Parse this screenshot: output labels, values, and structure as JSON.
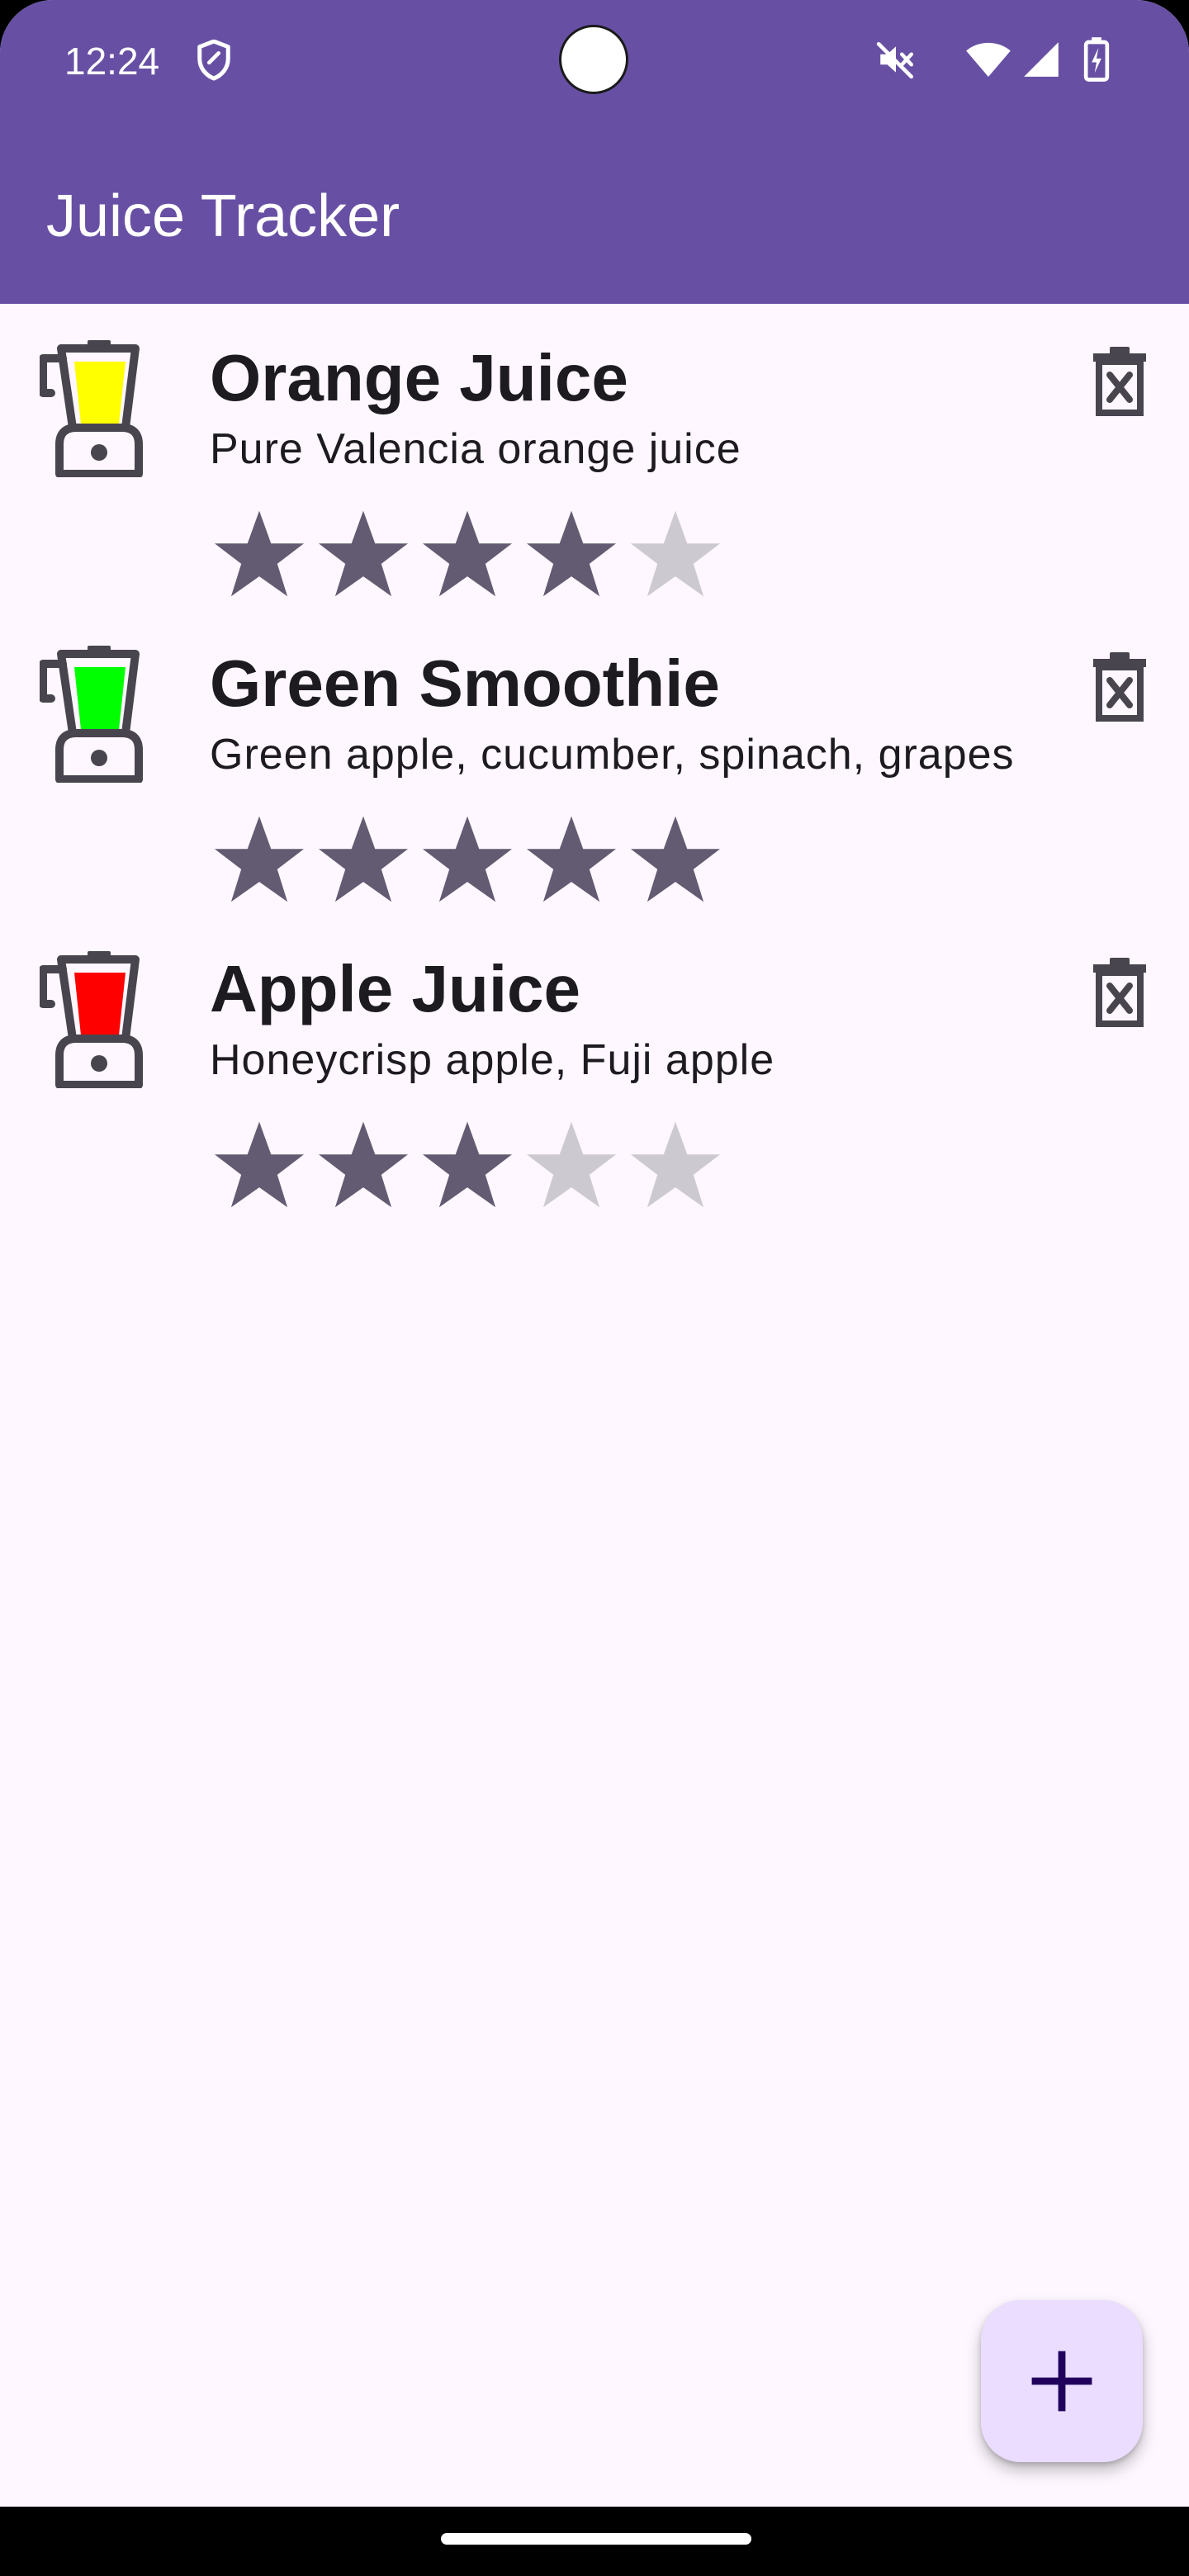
{
  "status_bar": {
    "time": "12:24",
    "icons": [
      "shield-icon",
      "mute-icon",
      "wifi-icon",
      "signal-icon",
      "battery-charging-icon"
    ]
  },
  "app_bar": {
    "title": "Juice Tracker",
    "color": "#6750a4"
  },
  "juices": [
    {
      "name": "Orange Juice",
      "description": "Pure Valencia orange juice",
      "color": "#ffff00",
      "rating": 4,
      "max_rating": 5
    },
    {
      "name": "Green Smoothie",
      "description": "Green apple, cucumber, spinach, grapes",
      "color": "#00ff00",
      "rating": 5,
      "max_rating": 5
    },
    {
      "name": "Apple Juice",
      "description": "Honeycrisp apple, Fuji apple",
      "color": "#ff0000",
      "rating": 3,
      "max_rating": 5
    }
  ],
  "fab": {
    "icon": "plus-icon",
    "color": "#eaddff"
  },
  "colors": {
    "star_filled": "#625b71",
    "star_empty": "#cdc9d1",
    "icon_dark": "#49454f",
    "background": "#fef7ff"
  }
}
